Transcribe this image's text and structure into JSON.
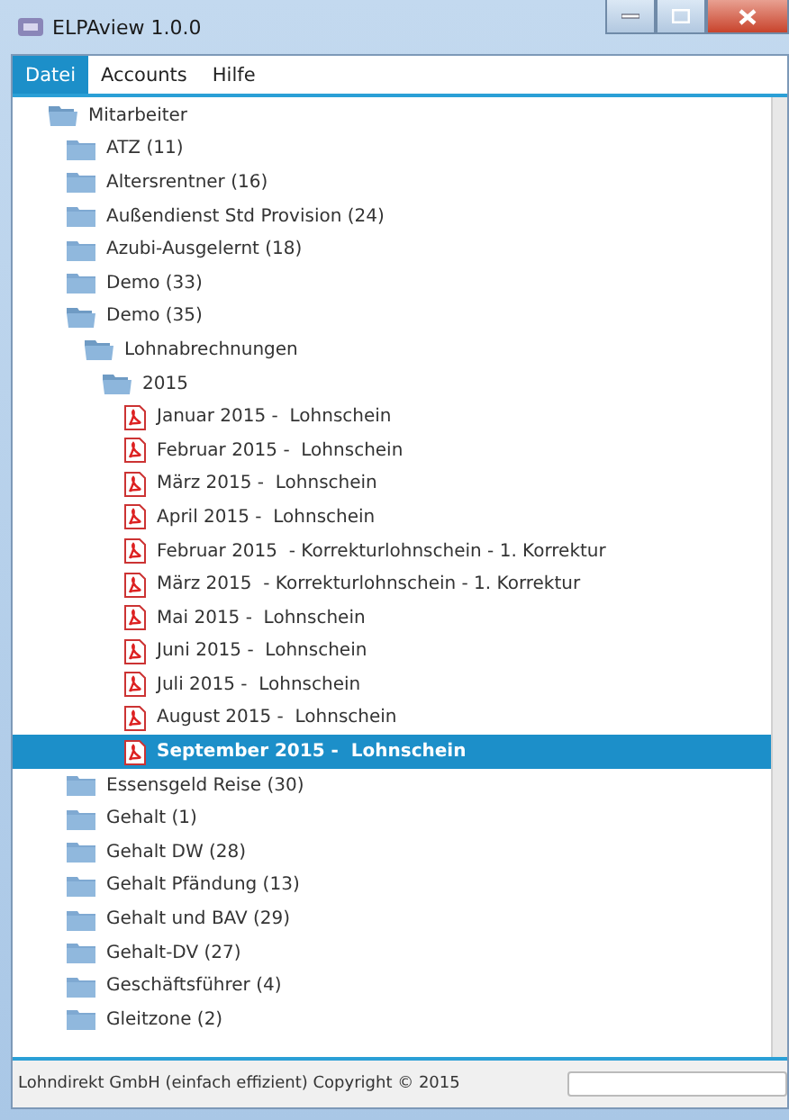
{
  "window": {
    "title": "ELPAview 1.0.0"
  },
  "menu": [
    {
      "label": "Datei",
      "selected": true
    },
    {
      "label": "Accounts",
      "selected": false
    },
    {
      "label": "Hilfe",
      "selected": false
    }
  ],
  "tree": [
    {
      "kind": "folder",
      "label": "Mitarbeiter",
      "expanded": true,
      "selected": false,
      "children": [
        {
          "kind": "folder",
          "label": "ATZ (11)",
          "expanded": false,
          "selected": false
        },
        {
          "kind": "folder",
          "label": "Altersrentner (16)",
          "expanded": false,
          "selected": false
        },
        {
          "kind": "folder",
          "label": "Außendienst Std Provision (24)",
          "expanded": false,
          "selected": false
        },
        {
          "kind": "folder",
          "label": "Azubi-Ausgelernt (18)",
          "expanded": false,
          "selected": false
        },
        {
          "kind": "folder",
          "label": "Demo (33)",
          "expanded": false,
          "selected": false
        },
        {
          "kind": "folder",
          "label": "Demo (35)",
          "expanded": true,
          "selected": false,
          "children": [
            {
              "kind": "folder",
              "label": "Lohnabrechnungen",
              "expanded": true,
              "selected": false,
              "children": [
                {
                  "kind": "folder",
                  "label": "2015",
                  "expanded": true,
                  "selected": false,
                  "children": [
                    {
                      "kind": "pdf",
                      "label": "Januar 2015 -  Lohnschein",
                      "selected": false
                    },
                    {
                      "kind": "pdf",
                      "label": "Februar 2015 -  Lohnschein",
                      "selected": false
                    },
                    {
                      "kind": "pdf",
                      "label": "März 2015 -  Lohnschein",
                      "selected": false
                    },
                    {
                      "kind": "pdf",
                      "label": "April 2015 -  Lohnschein",
                      "selected": false
                    },
                    {
                      "kind": "pdf",
                      "label": "Februar 2015  - Korrekturlohnschein - 1. Korrektur",
                      "selected": false
                    },
                    {
                      "kind": "pdf",
                      "label": "März 2015  - Korrekturlohnschein - 1. Korrektur",
                      "selected": false
                    },
                    {
                      "kind": "pdf",
                      "label": "Mai 2015 -  Lohnschein",
                      "selected": false
                    },
                    {
                      "kind": "pdf",
                      "label": "Juni 2015 -  Lohnschein",
                      "selected": false
                    },
                    {
                      "kind": "pdf",
                      "label": "Juli 2015 -  Lohnschein",
                      "selected": false
                    },
                    {
                      "kind": "pdf",
                      "label": "August 2015 -  Lohnschein",
                      "selected": false
                    },
                    {
                      "kind": "pdf",
                      "label": "September 2015 -  Lohnschein",
                      "selected": true
                    }
                  ]
                }
              ]
            }
          ]
        },
        {
          "kind": "folder",
          "label": "Essensgeld Reise (30)",
          "expanded": false,
          "selected": false
        },
        {
          "kind": "folder",
          "label": "Gehalt (1)",
          "expanded": false,
          "selected": false
        },
        {
          "kind": "folder",
          "label": "Gehalt DW (28)",
          "expanded": false,
          "selected": false
        },
        {
          "kind": "folder",
          "label": "Gehalt Pfändung (13)",
          "expanded": false,
          "selected": false
        },
        {
          "kind": "folder",
          "label": "Gehalt und BAV (29)",
          "expanded": false,
          "selected": false
        },
        {
          "kind": "folder",
          "label": "Gehalt-DV (27)",
          "expanded": false,
          "selected": false
        },
        {
          "kind": "folder",
          "label": "Geschäftsführer (4)",
          "expanded": false,
          "selected": false
        },
        {
          "kind": "folder",
          "label": "Gleitzone (2)",
          "expanded": false,
          "selected": false
        }
      ]
    }
  ],
  "status_bar": {
    "text": "Lohndirekt GmbH (einfach effizient) Copyright © 2015",
    "progress": {
      "level": 0
    }
  }
}
